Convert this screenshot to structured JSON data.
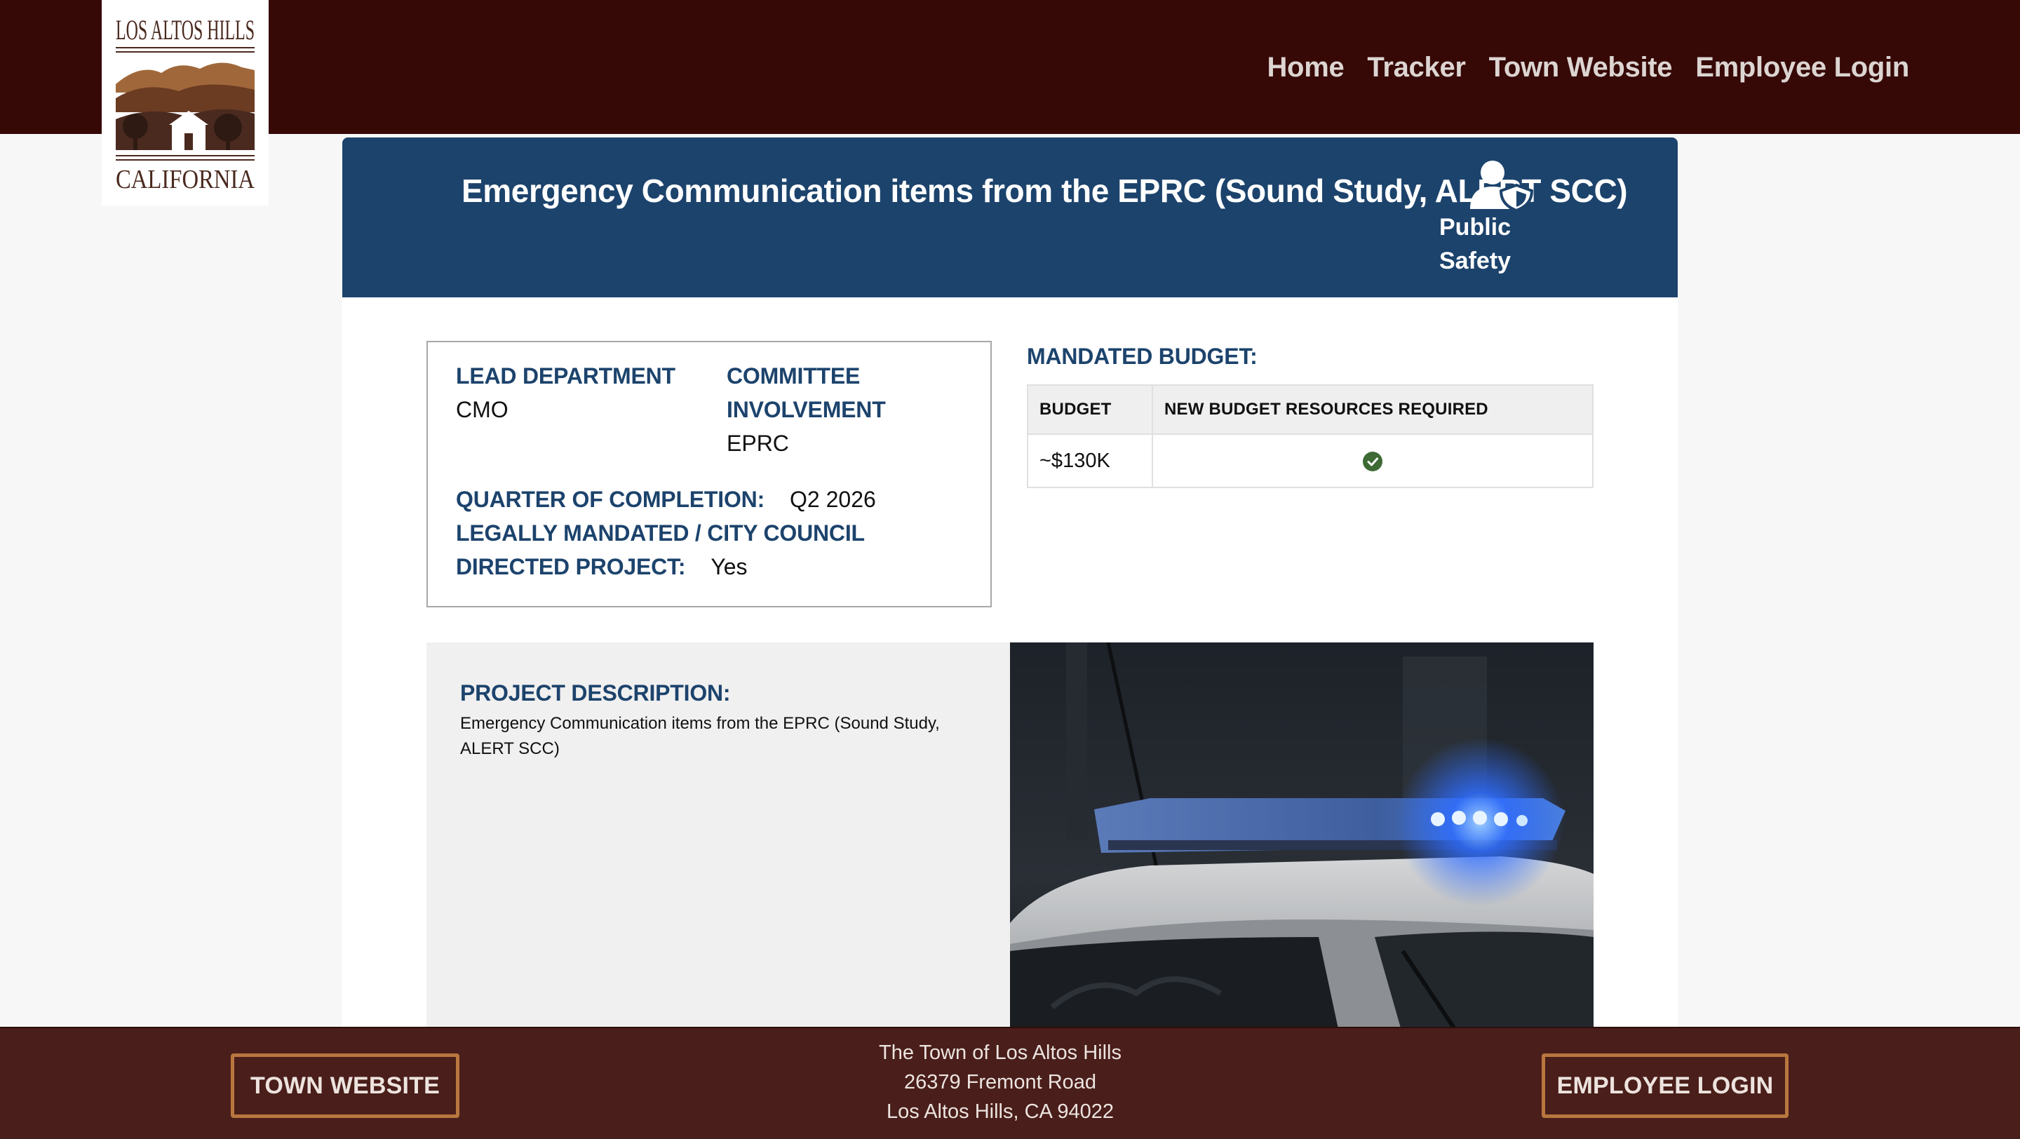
{
  "logo": {
    "top_text": "LOS ALTOS HILLS",
    "bottom_text": "CALIFORNIA"
  },
  "nav": {
    "items": [
      "Home",
      "Tracker",
      "Town Website",
      "Employee Login"
    ]
  },
  "project": {
    "title": "Emergency Communication items from the EPRC (Sound Study, ALERT SCC)",
    "category": {
      "label": "Public Safety",
      "icon": "user-shield-icon"
    }
  },
  "info": {
    "lead_department_label": "LEAD DEPARTMENT",
    "lead_department_value": "CMO",
    "committee_label": "COMMITTEE INVOLVEMENT",
    "committee_value": "EPRC",
    "quarter_label": "QUARTER OF COMPLETION:",
    "quarter_value": "Q2 2026",
    "mandated_label": "LEGALLY MANDATED / CITY COUNCIL DIRECTED PROJECT:",
    "mandated_value": "Yes"
  },
  "budget": {
    "title": "MANDATED BUDGET:",
    "columns": [
      "BUDGET",
      "NEW BUDGET RESOURCES REQUIRED"
    ],
    "budget_value": "~$130K",
    "new_resources_required": true,
    "status_color": "#3d6a35"
  },
  "description": {
    "title": "PROJECT DESCRIPTION:",
    "text": "Emergency Communication items from the EPRC (Sound Study, ALERT SCC)"
  },
  "footer": {
    "left_button": "TOWN WEBSITE",
    "right_button": "EMPLOYEE LOGIN",
    "address": [
      "The Town of Los Altos Hills",
      "26379 Fremont Road",
      "Los Altos Hills, CA 94022"
    ]
  },
  "colors": {
    "header_bg": "#360806",
    "banner_bg": "#1c436c",
    "label_blue": "#1c436c",
    "footer_bg": "#4a1e1a",
    "footer_button_border": "#b8773f"
  }
}
